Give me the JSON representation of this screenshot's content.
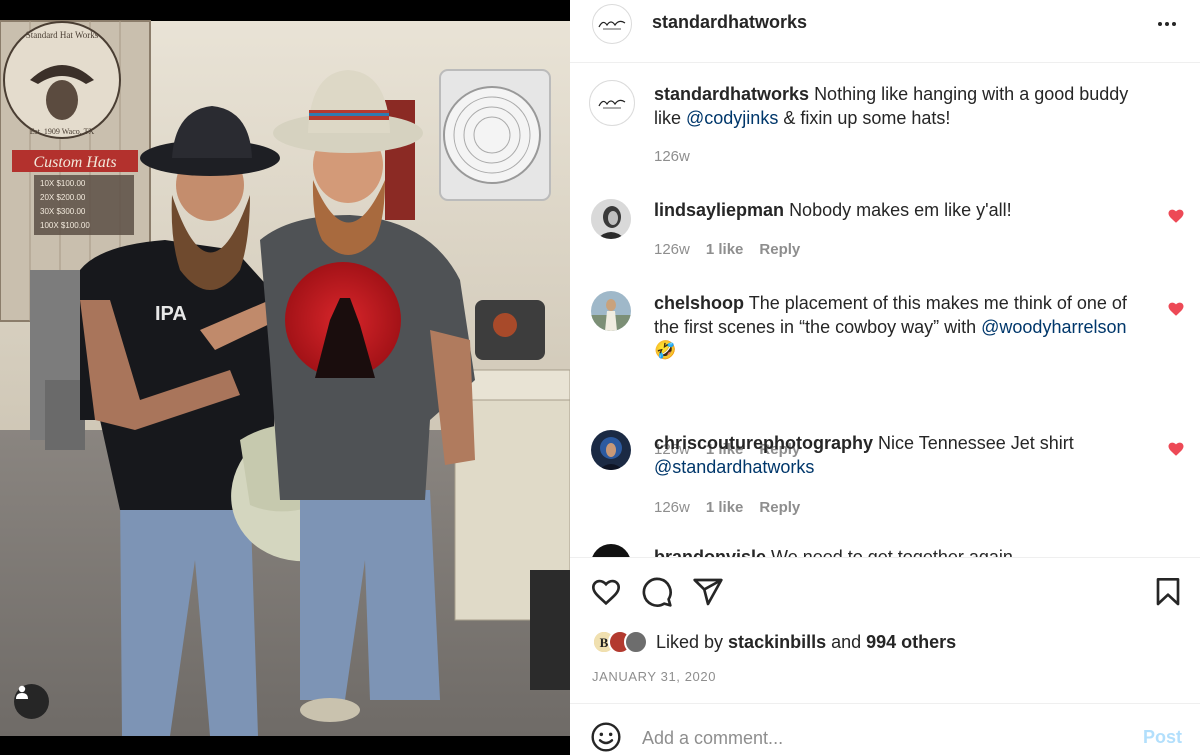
{
  "post": {
    "owner": "standardhatworks",
    "caption_username": "standardhatworks",
    "caption_text_before": "Nothing like hanging with a good buddy like ",
    "caption_mention": "@codyjinks",
    "caption_text_after": " & fixin up some hats!",
    "caption_time": "126w",
    "photo_sign": {
      "brand_top": "Standard Hat Works",
      "est": "Est. 1909 Waco, TX",
      "banner": "Custom Hats",
      "price_rows": [
        "10X  $100.00",
        "20X  $200.00",
        "30X  $300.00",
        "100X $100.00"
      ]
    }
  },
  "comments": [
    {
      "username": "lindsayliepman",
      "text": "Nobody makes em like y'all!",
      "mention": "",
      "emoji": "",
      "time": "126w",
      "likes": "1 like",
      "reply": "Reply"
    },
    {
      "username": "chelshoop",
      "text": "The placement of this makes me think of one of the first scenes in “the cowboy way” with ",
      "mention": "@woodyharrelson",
      "emoji": "🤣",
      "time": "126w",
      "likes": "1 like",
      "reply": "Reply"
    },
    {
      "username": "chriscouturephotography",
      "text": "Nice Tennessee Jet shirt ",
      "mention": "@standardhatworks",
      "emoji": "",
      "time": "126w",
      "likes": "1 like",
      "reply": "Reply"
    },
    {
      "username": "brandonvisle",
      "text": "We need to get together again",
      "mention": "",
      "emoji": "",
      "time": "",
      "likes": "",
      "reply": ""
    }
  ],
  "likes": {
    "prefix": "Liked by ",
    "user": "stackinbills",
    "middle": " and ",
    "others": "994 others"
  },
  "date": "JANUARY 31, 2020",
  "add_comment": {
    "placeholder": "Add a comment...",
    "post_label": "Post"
  },
  "icons": {
    "more": "more-options-icon",
    "like": "heart-outline-icon",
    "comment": "comment-bubble-icon",
    "share": "paper-plane-icon",
    "save": "bookmark-icon",
    "emoji": "smiley-icon",
    "comment_like": "heart-filled-icon",
    "tag": "user-tag-icon"
  },
  "colors": {
    "like_red": "#ed4956",
    "mention_blue": "#00376b",
    "muted": "#8e8e8e",
    "post_disabled": "#b2dffc"
  }
}
